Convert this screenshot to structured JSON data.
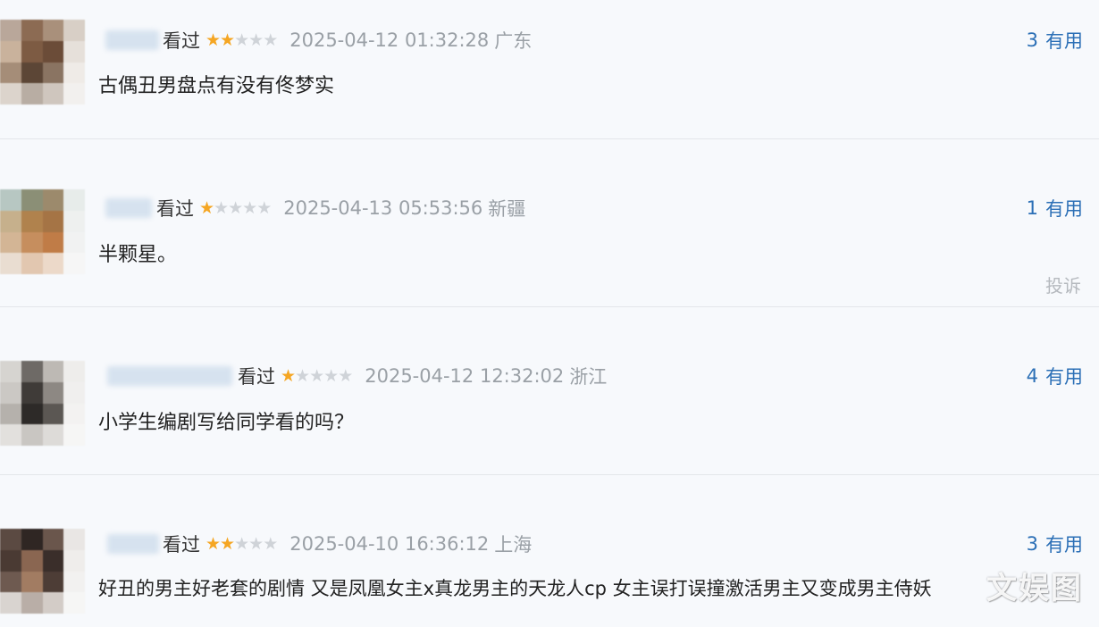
{
  "comments": [
    {
      "status": "看过",
      "rating": 2,
      "time": "2025-04-12 01:32:28",
      "location": "广东",
      "useful_count": "3",
      "useful_label": "有用",
      "content": "古偶丑男盘点有没有佟梦实"
    },
    {
      "status": "看过",
      "rating": 1,
      "time": "2025-04-13 05:53:56",
      "location": "新疆",
      "useful_count": "1",
      "useful_label": "有用",
      "content": "半颗星。",
      "report_label": "投诉"
    },
    {
      "status": "看过",
      "rating": 1,
      "time": "2025-04-12 12:32:02",
      "location": "浙江",
      "useful_count": "4",
      "useful_label": "有用",
      "content": "小学生编剧写给同学看的吗？"
    },
    {
      "status": "看过",
      "rating": 2,
      "time": "2025-04-10 16:36:12",
      "location": "上海",
      "useful_count": "3",
      "useful_label": "有用",
      "content": "好丑的男主好老套的剧情 又是凤凰女主x真龙男主的天龙人cp 女主误打误撞激活男主又变成男主侍妖"
    }
  ],
  "colors": {
    "accent": "#2b6fb6",
    "star_on": "#f5a623",
    "star_off": "#cfd3d8",
    "meta_gray": "#9aa0a6"
  },
  "watermark": "文娱图"
}
